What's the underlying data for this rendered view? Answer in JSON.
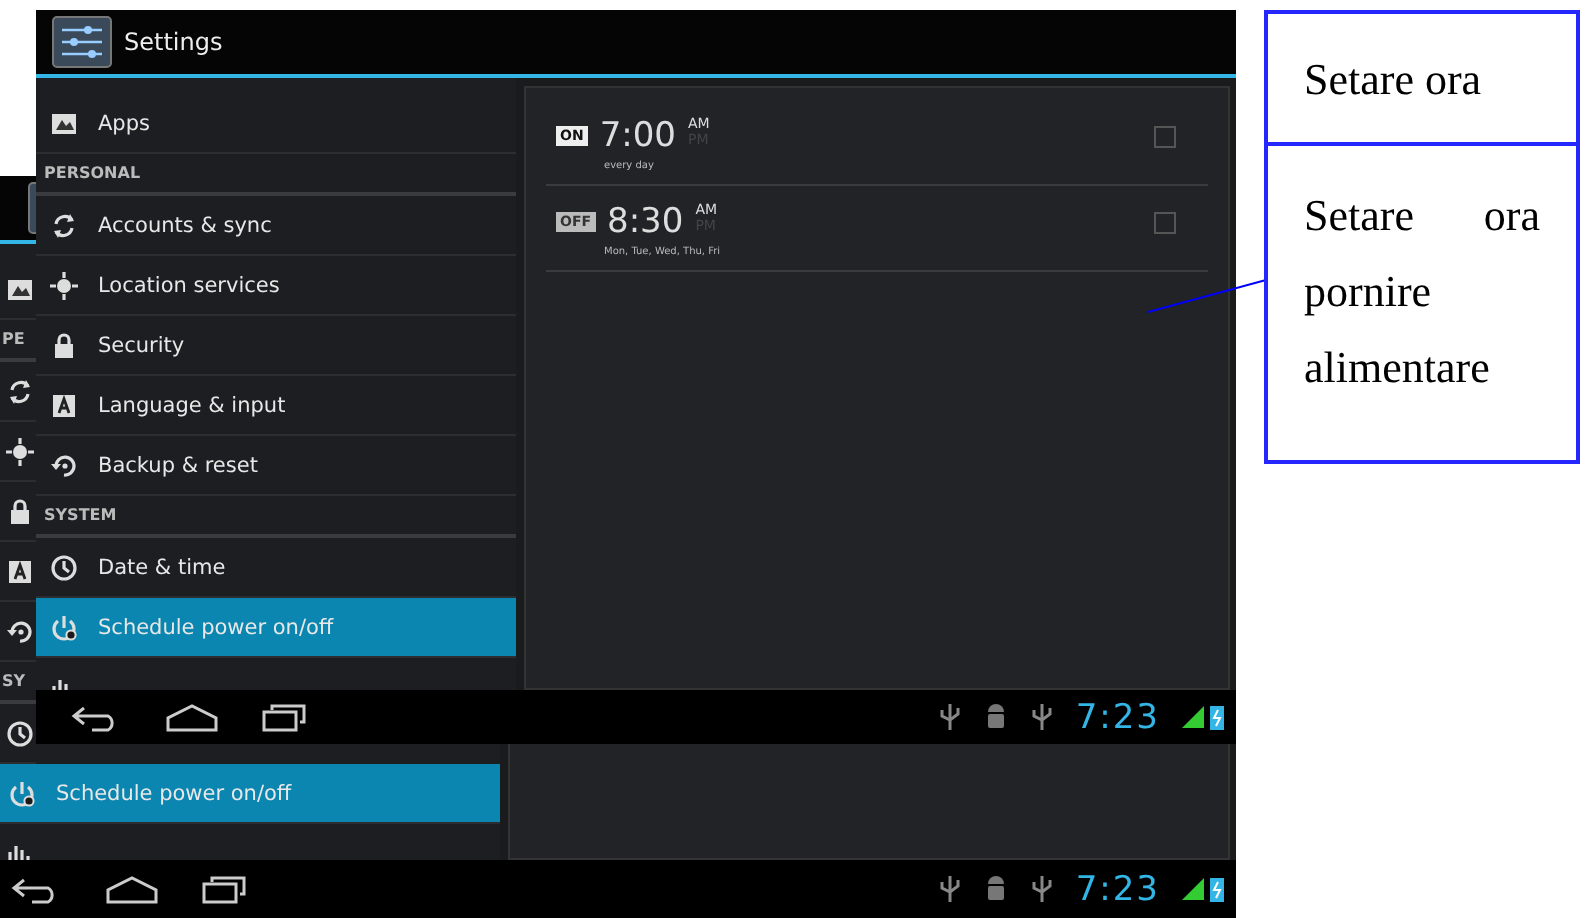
{
  "back_window": {
    "sidebar": {
      "items": [
        {
          "kind": "item",
          "selected": false
        },
        {
          "kind": "header",
          "label": "PE"
        },
        {
          "kind": "item",
          "selected": false
        },
        {
          "kind": "item",
          "selected": false
        },
        {
          "kind": "item",
          "selected": false
        },
        {
          "kind": "item",
          "selected": false
        },
        {
          "kind": "item",
          "selected": false
        },
        {
          "kind": "header",
          "label": "SY"
        },
        {
          "kind": "item",
          "selected": false
        },
        {
          "kind": "item",
          "label": "Schedule power on/off",
          "selected": true
        },
        {
          "kind": "item",
          "selected": false
        }
      ]
    },
    "status_bar": {
      "clock": "7:23"
    }
  },
  "front_window": {
    "title": "Settings",
    "sidebar": {
      "items": [
        {
          "kind": "item",
          "label": "Apps",
          "selected": false
        },
        {
          "kind": "header",
          "label": "PERSONAL"
        },
        {
          "kind": "item",
          "label": "Accounts & sync",
          "selected": false
        },
        {
          "kind": "item",
          "label": "Location services",
          "selected": false
        },
        {
          "kind": "item",
          "label": "Security",
          "selected": false
        },
        {
          "kind": "item",
          "label": "Language & input",
          "selected": false
        },
        {
          "kind": "item",
          "label": "Backup & reset",
          "selected": false
        },
        {
          "kind": "header",
          "label": "SYSTEM"
        },
        {
          "kind": "item",
          "label": "Date & time",
          "selected": false
        },
        {
          "kind": "item",
          "label": "Schedule power on/off",
          "selected": true
        },
        {
          "kind": "item",
          "selected": false
        }
      ]
    },
    "alarms": [
      {
        "badge": "ON",
        "on": true,
        "time": "7:00",
        "am": "AM",
        "pm": "PM",
        "am_selected": true,
        "repeat": "every day",
        "checked": false
      },
      {
        "badge": "OFF",
        "on": false,
        "time": "8:30",
        "am": "AM",
        "pm": "PM",
        "am_selected": true,
        "repeat": "Mon, Tue, Wed, Thu, Fri",
        "checked": false
      }
    ],
    "status_bar": {
      "clock": "7:23"
    }
  },
  "callouts": [
    {
      "text": "Setare ora"
    },
    {
      "text": "Setare ora pornire alimentare"
    }
  ]
}
